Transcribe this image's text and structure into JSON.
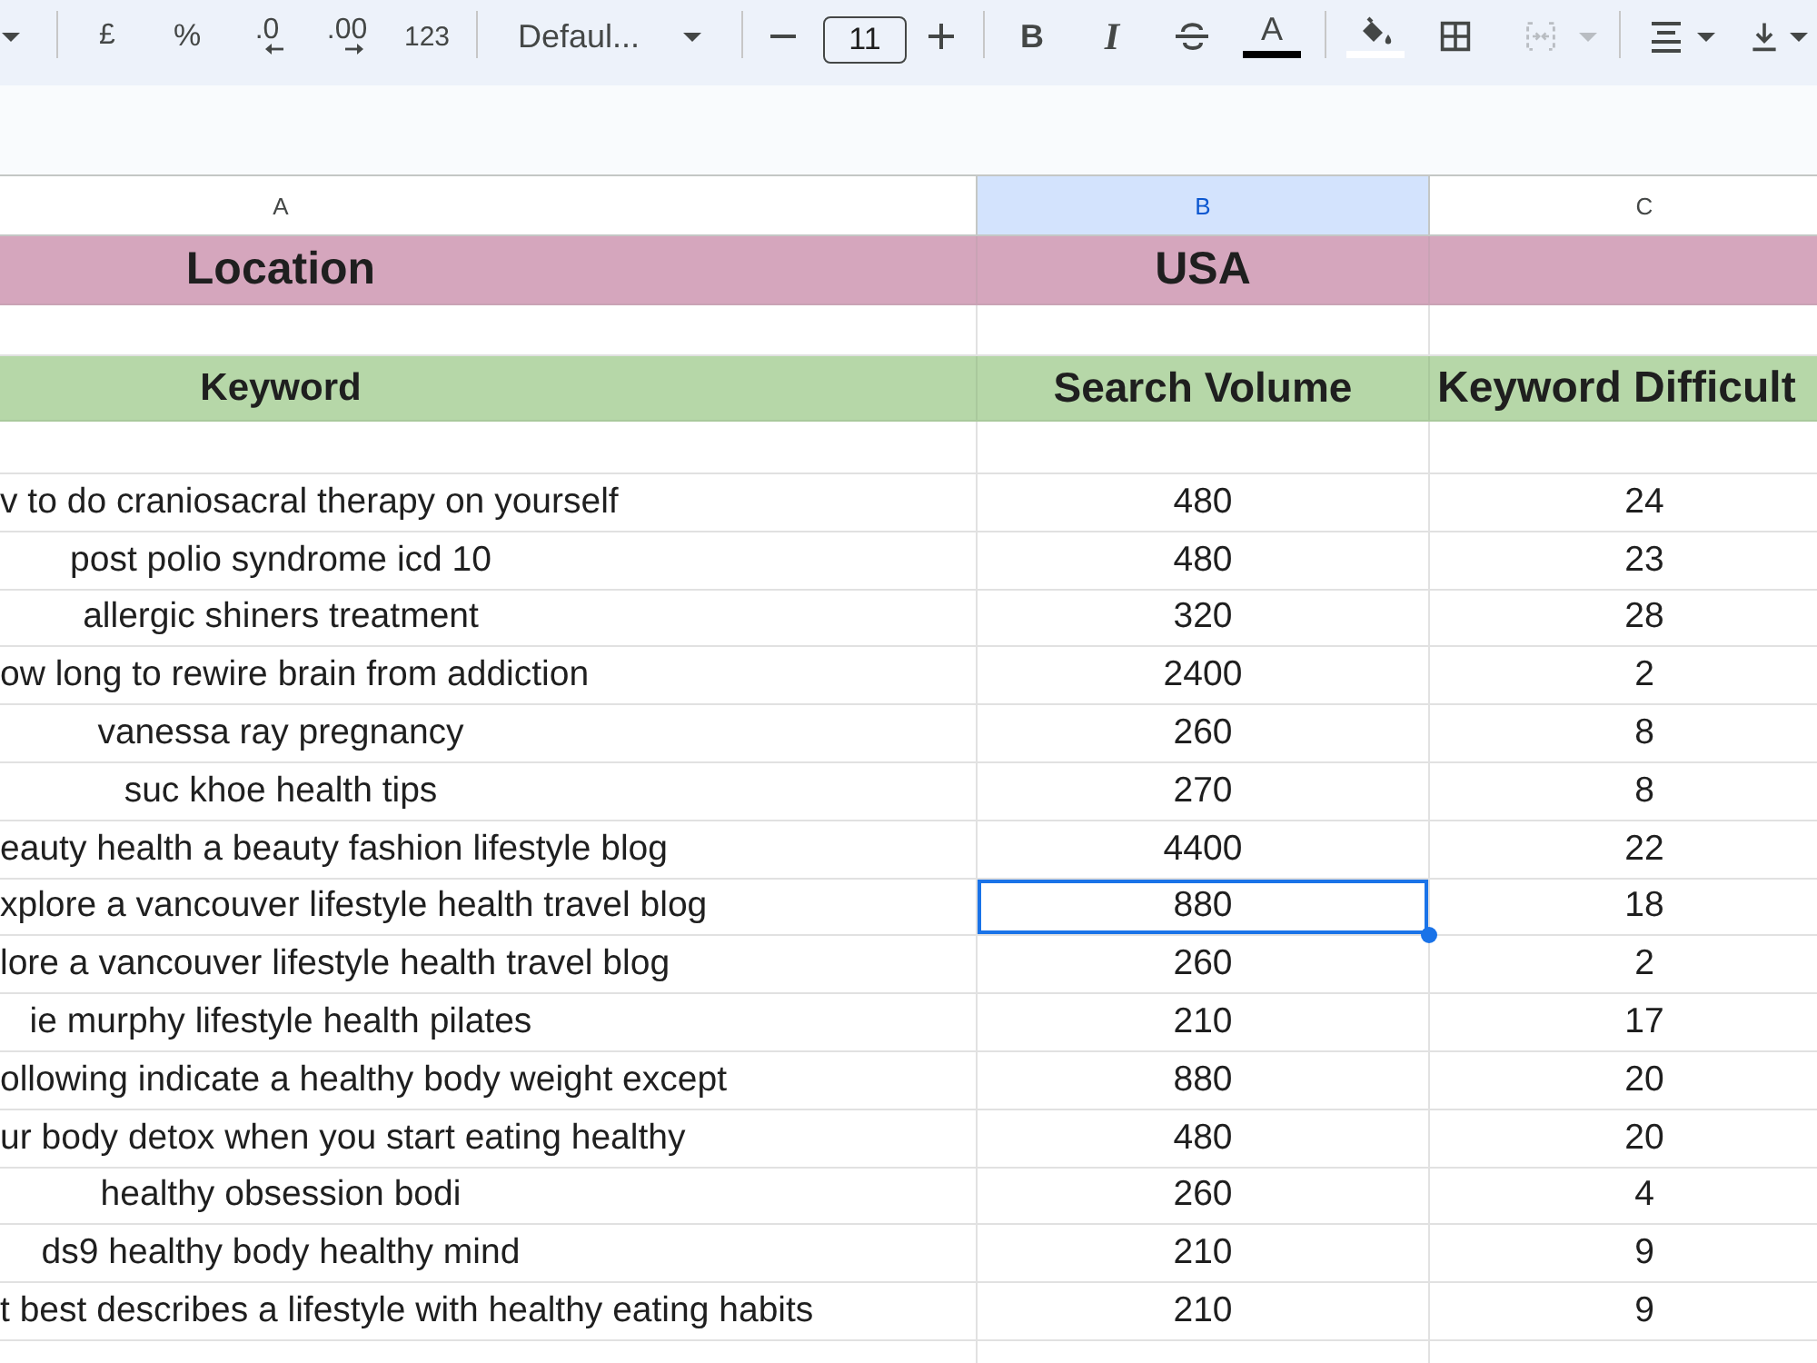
{
  "toolbar": {
    "groups": [
      [
        {
          "kind": "menu-caret",
          "disabled": false
        }
      ],
      [
        {
          "kind": "currency",
          "label": "£",
          "disabled": false
        },
        {
          "kind": "percent",
          "label": "%",
          "disabled": false
        },
        {
          "kind": "decimal-decrease",
          "label": ".0",
          "disabled": false
        },
        {
          "kind": "decimal-increase",
          "label": ".00",
          "disabled": false
        },
        {
          "kind": "number-format",
          "label": "123",
          "disabled": false
        }
      ],
      [
        {
          "kind": "font-select",
          "value": "Defaul...",
          "disabled": false
        }
      ],
      [
        {
          "kind": "size-decrease",
          "disabled": false
        },
        {
          "kind": "size-field",
          "value": "11",
          "disabled": false
        },
        {
          "kind": "size-increase",
          "disabled": false
        }
      ],
      [
        {
          "kind": "bold",
          "label": "B",
          "disabled": false
        },
        {
          "kind": "italic",
          "label": "I",
          "disabled": false
        },
        {
          "kind": "strikethrough",
          "disabled": false
        },
        {
          "kind": "text-color",
          "label": "A",
          "disabled": false
        }
      ],
      [
        {
          "kind": "fill-color",
          "disabled": false
        },
        {
          "kind": "borders",
          "disabled": false
        },
        {
          "kind": "merge",
          "disabled": true
        }
      ],
      [
        {
          "kind": "align",
          "disabled": false
        },
        {
          "kind": "valign",
          "disabled": false
        }
      ]
    ]
  },
  "sheet": {
    "columns": [
      {
        "label": "A",
        "selected": false
      },
      {
        "label": "B",
        "selected": true
      },
      {
        "label": "C",
        "selected": false
      }
    ],
    "location_row": {
      "label": "Location",
      "value": "USA"
    },
    "header_row": [
      "Keyword",
      "Search Volume",
      "Keyword Difficult"
    ],
    "rows": [
      {
        "keyword": "v to do craniosacral therapy on yourself",
        "volume": "480",
        "difficulty": "24",
        "selected": false
      },
      {
        "keyword": "post polio syndrome icd 10",
        "volume": "480",
        "difficulty": "23",
        "selected": false
      },
      {
        "keyword": "allergic shiners treatment",
        "volume": "320",
        "difficulty": "28",
        "selected": false
      },
      {
        "keyword": "ow long to rewire brain from addiction",
        "volume": "2400",
        "difficulty": "2",
        "selected": false
      },
      {
        "keyword": "vanessa ray pregnancy",
        "volume": "260",
        "difficulty": "8",
        "selected": false
      },
      {
        "keyword": "suc khoe health tips",
        "volume": "270",
        "difficulty": "8",
        "selected": false
      },
      {
        "keyword": "eauty health a beauty fashion lifestyle blog",
        "volume": "4400",
        "difficulty": "22",
        "selected": false
      },
      {
        "keyword": "xplore a vancouver lifestyle health travel blog",
        "volume": "880",
        "difficulty": "18",
        "selected": true
      },
      {
        "keyword": "lore a vancouver lifestyle health travel blog",
        "volume": "260",
        "difficulty": "2",
        "selected": false
      },
      {
        "keyword": "ie murphy lifestyle health pilates",
        "volume": "210",
        "difficulty": "17",
        "selected": false
      },
      {
        "keyword": "ollowing indicate a healthy body weight except",
        "volume": "880",
        "difficulty": "20",
        "selected": false
      },
      {
        "keyword": "ur body detox when you start eating healthy",
        "volume": "480",
        "difficulty": "20",
        "selected": false
      },
      {
        "keyword": "healthy obsession bodi",
        "volume": "260",
        "difficulty": "4",
        "selected": false
      },
      {
        "keyword": "ds9 healthy body healthy mind",
        "volume": "210",
        "difficulty": "9",
        "selected": false
      },
      {
        "keyword": "t best describes a lifestyle with healthy eating habits",
        "volume": "210",
        "difficulty": "9",
        "selected": false
      }
    ]
  }
}
